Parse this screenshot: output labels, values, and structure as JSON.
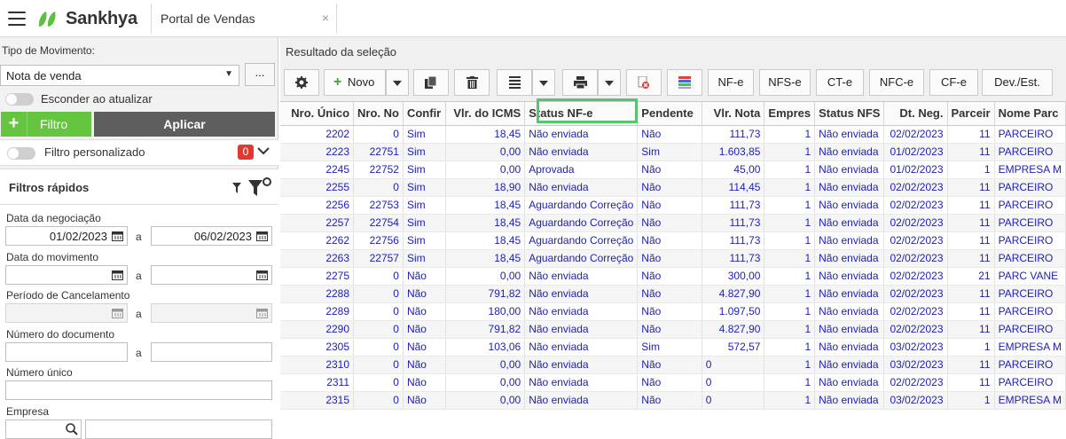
{
  "header": {
    "brand": "Sankhya",
    "tab_label": "Portal de Vendas",
    "tab_close": "×"
  },
  "left": {
    "tipo_label": "Tipo de Movimento:",
    "tipo_value": "Nota de venda",
    "dots_label": "...",
    "esconder_label": "Esconder ao atualizar",
    "filtro_label": "Filtro",
    "aplicar_label": "Aplicar",
    "filtro_personalizado_label": "Filtro personalizado",
    "filtro_personalizado_count": "0",
    "filtros_rapidos_title": "Filtros rápidos",
    "data_negociacao_label": "Data da negociação",
    "data_negociacao_de": "01/02/2023",
    "data_negociacao_ate": "06/02/2023",
    "a_sep": "a",
    "data_movimento_label": "Data do movimento",
    "periodo_cancelamento_label": "Período de Cancelamento",
    "numero_documento_label": "Número do documento",
    "numero_unico_label": "Número único",
    "empresa_label": "Empresa"
  },
  "results": {
    "title": "Resultado da seleção",
    "toolbar": {
      "novo": "Novo",
      "nfe": "NF-e",
      "nfse": "NFS-e",
      "cte": "CT-e",
      "nfce": "NFC-e",
      "cfe": "CF-e",
      "dev": "Dev./Est."
    },
    "columns": [
      "Nro. Único",
      "Nro. No",
      "Confir",
      "Vlr. do ICMS",
      "Status NF-e",
      "Pendente",
      "Vlr. Nota",
      "Empres",
      "Status NFS",
      "Dt. Neg.",
      "Parceir",
      "Nome Parc"
    ],
    "rows": [
      [
        "2202",
        "0",
        "Sim",
        "18,45",
        "Não enviada",
        "Não",
        "111,73",
        "1",
        "Não enviada",
        "02/02/2023",
        "11",
        "PARCEIRO"
      ],
      [
        "2223",
        "22751",
        "Sim",
        "0,00",
        "Não enviada",
        "Sim",
        "1.603,85",
        "1",
        "Não enviada",
        "01/02/2023",
        "11",
        "PARCEIRO"
      ],
      [
        "2245",
        "22752",
        "Sim",
        "0,00",
        "Aprovada",
        "Não",
        "45,00",
        "1",
        "Não enviada",
        "01/02/2023",
        "1",
        "EMPRESA M"
      ],
      [
        "2255",
        "0",
        "Sim",
        "18,90",
        "Não enviada",
        "Não",
        "114,45",
        "1",
        "Não enviada",
        "02/02/2023",
        "11",
        "PARCEIRO"
      ],
      [
        "2256",
        "22753",
        "Sim",
        "18,45",
        "Aguardando Correção",
        "Não",
        "111,73",
        "1",
        "Não enviada",
        "02/02/2023",
        "11",
        "PARCEIRO"
      ],
      [
        "2257",
        "22754",
        "Sim",
        "18,45",
        "Aguardando Correção",
        "Não",
        "111,73",
        "1",
        "Não enviada",
        "02/02/2023",
        "11",
        "PARCEIRO"
      ],
      [
        "2262",
        "22756",
        "Sim",
        "18,45",
        "Aguardando Correção",
        "Não",
        "111,73",
        "1",
        "Não enviada",
        "02/02/2023",
        "11",
        "PARCEIRO"
      ],
      [
        "2263",
        "22757",
        "Sim",
        "18,45",
        "Aguardando Correção",
        "Não",
        "111,73",
        "1",
        "Não enviada",
        "02/02/2023",
        "11",
        "PARCEIRO"
      ],
      [
        "2275",
        "0",
        "Não",
        "0,00",
        "Não enviada",
        "Não",
        "300,00",
        "1",
        "Não enviada",
        "02/02/2023",
        "21",
        "PARC VANE"
      ],
      [
        "2288",
        "0",
        "Não",
        "791,82",
        "Não enviada",
        "Não",
        "4.827,90",
        "1",
        "Não enviada",
        "02/02/2023",
        "11",
        "PARCEIRO"
      ],
      [
        "2289",
        "0",
        "Não",
        "180,00",
        "Não enviada",
        "Não",
        "1.097,50",
        "1",
        "Não enviada",
        "02/02/2023",
        "11",
        "PARCEIRO"
      ],
      [
        "2290",
        "0",
        "Não",
        "791,82",
        "Não enviada",
        "Não",
        "4.827,90",
        "1",
        "Não enviada",
        "02/02/2023",
        "11",
        "PARCEIRO"
      ],
      [
        "2305",
        "0",
        "Não",
        "103,06",
        "Não enviada",
        "Sim",
        "572,57",
        "1",
        "Não enviada",
        "03/02/2023",
        "1",
        "EMPRESA M"
      ],
      [
        "2310",
        "0",
        "Não",
        "0,00",
        "Não enviada",
        "Não",
        "0",
        "1",
        "Não enviada",
        "03/02/2023",
        "11",
        "PARCEIRO"
      ],
      [
        "2311",
        "0",
        "Não",
        "0,00",
        "Não enviada",
        "Não",
        "0",
        "1",
        "Não enviada",
        "02/02/2023",
        "11",
        "PARCEIRO"
      ],
      [
        "2315",
        "0",
        "Não",
        "0,00",
        "Não enviada",
        "Não",
        "0",
        "1",
        "Não enviada",
        "03/02/2023",
        "1",
        "EMPRESA M"
      ]
    ]
  },
  "colors": {
    "accent_green": "#66c53f",
    "aplicar_bg": "#5e5e5e",
    "badge_red": "#e0392f",
    "cell_text": "#1d1db8",
    "highlight": "#57c56b"
  },
  "icons": [
    "hamburger-icon",
    "sankhya-logo-icon",
    "gear-icon",
    "plus-icon",
    "chevron-down-icon",
    "copy-icon",
    "trash-icon",
    "list-icon",
    "printer-icon",
    "cancel-doc-icon",
    "color-bars-icon",
    "calendar-icon",
    "search-icon",
    "filter-icon",
    "filter-settings-icon"
  ]
}
